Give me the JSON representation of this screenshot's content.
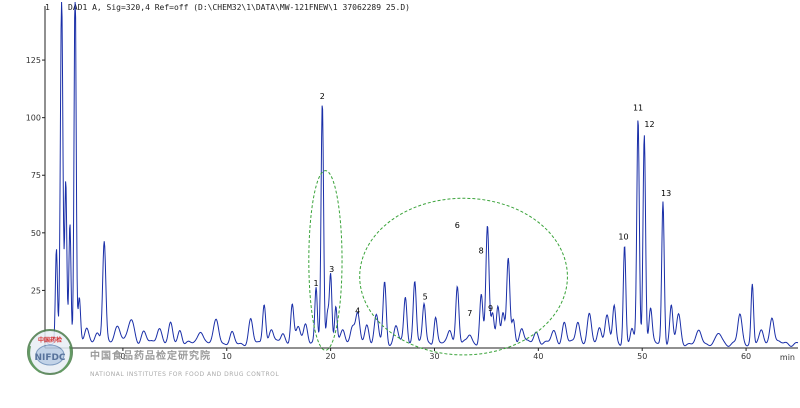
{
  "header": {
    "text": "DAD1 A, Sig=320,4 Ref=off (D:\\CHEM32\\1\\DATA\\MW-121FNEW\\1 37062289 25.D)",
    "tick_marker": "1"
  },
  "logo": {
    "abbr": "NIFDC",
    "seal_text": "中国药检",
    "chinese": "中国食品药品检定研究院",
    "english": "NATIONAL INSTITUTES FOR FOOD AND DRUG CONTROL"
  },
  "colors": {
    "trace": "#1a2fa8",
    "circle": "#3aa33a",
    "axis": "#222222"
  },
  "chart_data": {
    "type": "line",
    "title": "",
    "xlabel": "",
    "ylabel": "",
    "x_unit": "min",
    "xlim": [
      -7.5,
      65
    ],
    "ylim": [
      0,
      145
    ],
    "x_ticks": [
      0,
      10,
      20,
      30,
      40,
      50,
      60
    ],
    "y_ticks": [
      25,
      50,
      75,
      100,
      125
    ],
    "x_tick_labels": [
      "0",
      "10",
      "20",
      "30",
      "40",
      "50",
      "60"
    ],
    "y_tick_labels": [
      "25",
      "50",
      "75",
      "100",
      "125"
    ],
    "x_edge_label": "min",
    "series": [
      {
        "baseline": 2,
        "peaks": [
          [
            -6.4,
            42,
            0.1
          ],
          [
            -5.9,
            150,
            0.12
          ],
          [
            -5.5,
            70,
            0.1
          ],
          [
            -5.1,
            52,
            0.1
          ],
          [
            -4.6,
            160,
            0.1
          ],
          [
            -4.2,
            20,
            0.12
          ],
          [
            -3.5,
            6,
            0.2
          ],
          [
            -2.5,
            5,
            0.25
          ],
          [
            -1.8,
            44,
            0.15
          ],
          [
            -0.5,
            8,
            0.3
          ],
          [
            0.8,
            10,
            0.3
          ],
          [
            2.0,
            5,
            0.25
          ],
          [
            3.5,
            7,
            0.25
          ],
          [
            4.6,
            8,
            0.2
          ],
          [
            5.5,
            6,
            0.2
          ],
          [
            7.5,
            6,
            0.25
          ],
          [
            9.0,
            10,
            0.25
          ],
          [
            10.5,
            4,
            0.2
          ],
          [
            12.3,
            10,
            0.2
          ],
          [
            13.6,
            18,
            0.15
          ],
          [
            14.3,
            6,
            0.2
          ],
          [
            15.4,
            5,
            0.2
          ],
          [
            16.3,
            17,
            0.15
          ],
          [
            16.9,
            7,
            0.2
          ],
          [
            17.6,
            9,
            0.2
          ],
          [
            18.6,
            24,
            0.12
          ],
          [
            19.2,
            104,
            0.12
          ],
          [
            19.7,
            14,
            0.12
          ],
          [
            20.0,
            30,
            0.12
          ],
          [
            20.5,
            16,
            0.12
          ],
          [
            21.2,
            6,
            0.2
          ],
          [
            22.1,
            8,
            0.2
          ],
          [
            22.6,
            12,
            0.2
          ],
          [
            23.5,
            8,
            0.2
          ],
          [
            24.4,
            12,
            0.2
          ],
          [
            25.2,
            26,
            0.15
          ],
          [
            26.3,
            8,
            0.2
          ],
          [
            27.2,
            20,
            0.15
          ],
          [
            28.1,
            28,
            0.15
          ],
          [
            29.0,
            17,
            0.15
          ],
          [
            30.1,
            12,
            0.15
          ],
          [
            31.5,
            6,
            0.2
          ],
          [
            32.2,
            25,
            0.15
          ],
          [
            33.4,
            4,
            0.2
          ],
          [
            34.5,
            21,
            0.15
          ],
          [
            35.1,
            51,
            0.15
          ],
          [
            35.6,
            13,
            0.15
          ],
          [
            36.1,
            17,
            0.15
          ],
          [
            36.6,
            13,
            0.15
          ],
          [
            37.1,
            36,
            0.15
          ],
          [
            37.6,
            11,
            0.15
          ],
          [
            38.4,
            7,
            0.2
          ],
          [
            39.8,
            5,
            0.25
          ],
          [
            41.5,
            5,
            0.25
          ],
          [
            42.5,
            9,
            0.2
          ],
          [
            43.8,
            10,
            0.2
          ],
          [
            44.9,
            12,
            0.2
          ],
          [
            45.9,
            7,
            0.2
          ],
          [
            46.6,
            12,
            0.2
          ],
          [
            47.3,
            16,
            0.15
          ],
          [
            48.3,
            43,
            0.12
          ],
          [
            49.0,
            6,
            0.15
          ],
          [
            49.6,
            98,
            0.12
          ],
          [
            50.2,
            91,
            0.12
          ],
          [
            50.8,
            15,
            0.15
          ],
          [
            52.0,
            62,
            0.12
          ],
          [
            52.8,
            16,
            0.15
          ],
          [
            53.5,
            12,
            0.2
          ],
          [
            55.5,
            5,
            0.25
          ],
          [
            57.4,
            4,
            0.25
          ],
          [
            59.4,
            12,
            0.2
          ],
          [
            60.6,
            26,
            0.12
          ],
          [
            61.5,
            5,
            0.2
          ],
          [
            62.5,
            12,
            0.2
          ]
        ]
      }
    ],
    "annotations": [
      {
        "label": "2",
        "x": 19.2,
        "y": 108
      },
      {
        "label": "1",
        "x": 18.6,
        "y": 27
      },
      {
        "label": "3",
        "x": 20.1,
        "y": 33
      },
      {
        "label": "4",
        "x": 22.6,
        "y": 15
      },
      {
        "label": "5",
        "x": 29.1,
        "y": 21
      },
      {
        "label": "6",
        "x": 32.2,
        "y": 52
      },
      {
        "label": "7",
        "x": 33.4,
        "y": 14
      },
      {
        "label": "8",
        "x": 34.5,
        "y": 41
      },
      {
        "label": "9",
        "x": 35.4,
        "y": 16
      },
      {
        "label": "10",
        "x": 48.2,
        "y": 47
      },
      {
        "label": "11",
        "x": 49.6,
        "y": 103
      },
      {
        "label": "12",
        "x": 50.7,
        "y": 96
      },
      {
        "label": "13",
        "x": 52.3,
        "y": 66
      }
    ],
    "highlights": [
      {
        "cx": 19.5,
        "cy": 38,
        "rx": 1.6,
        "ry": 39
      },
      {
        "cx": 32.8,
        "cy": 31,
        "rx": 10,
        "ry": 34
      }
    ],
    "grid": false,
    "legend": "none"
  }
}
